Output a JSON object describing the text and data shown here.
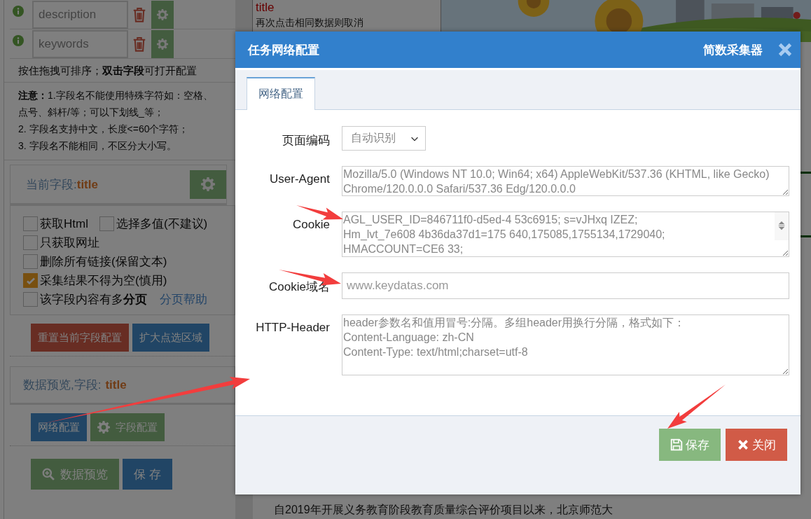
{
  "left_panel": {
    "fields": [
      {
        "name": "description"
      },
      {
        "name": "keywords"
      }
    ],
    "hint": "按住拖拽可排序；**双击字段**可打开配置",
    "notice": [
      "**注意：**1.字段名不能使用特殊字符如：空格、点号、斜杆/等；可以下划线_等；",
      "2. 字段名支持中文，长度<=60个字符；",
      "3. 字段名不能相同，不区分大小写。"
    ],
    "current_field": {
      "label": "当前字段:",
      "value": "title"
    },
    "option_lines": [
      {
        "items": [
          {
            "label": "获取Html",
            "checked": false
          },
          {
            "label": "选择多值(不建议)",
            "checked": false
          }
        ]
      },
      {
        "items": [
          {
            "label": "只获取网址",
            "checked": false
          }
        ]
      },
      {
        "items": [
          {
            "label": "删除所有链接(保留文本)",
            "checked": false
          }
        ]
      },
      {
        "items": [
          {
            "label": "采集结果不得为空(慎用)",
            "checked": true
          }
        ]
      },
      {
        "items": [
          {
            "label": "该字段内容有多**分页**",
            "checked": false
          }
        ],
        "link": "分页帮助"
      }
    ],
    "field_buttons": [
      {
        "label": "重置当前字段配置",
        "kind": "danger"
      },
      {
        "label": "扩大点选区域",
        "kind": "primary"
      }
    ],
    "preview": {
      "label": "数据预览,字段:",
      "value": "title"
    },
    "button_rows": [
      [
        {
          "label": "网络配置",
          "kind": "primary"
        },
        {
          "label": "字段配置",
          "kind": "success"
        }
      ],
      [
        {
          "label": "数据预览",
          "kind": "success"
        },
        {
          "label": "保 存",
          "kind": "primary"
        }
      ]
    ]
  },
  "page": {
    "tip_title": "title",
    "tip_text": "再次点击相同数据则取消",
    "paragraph": "自2019年开展义务教育阶段教育质量综合评价项目以来，北京师范大"
  },
  "dialog": {
    "title": "任务网络配置",
    "brand": "简数采集器",
    "tabs": [
      {
        "label": "网络配置",
        "selected": true
      }
    ],
    "fields": [
      {
        "label": "页面编码",
        "kind": "select",
        "value": "自动识别"
      },
      {
        "label": "User-Agent",
        "kind": "textarea",
        "value": "Mozilla/5.0 (Windows NT 10.0; Win64; x64) AppleWebKit/537.36 (KHTML, like Gecko) Chrome/120.0.0.0 Safari/537.36 Edg/120.0.0.0"
      },
      {
        "label": "Cookie",
        "kind": "textarea",
        "scroll": true,
        "value": "AGL_USER_ID=846711f0-d5ed-4 53c6915; s=vJHxq IZEZ;\nHm_lvt_7e608 4b36da37d1=175 640,175085,1755134,1729040;\nHMACCOUNT=CE6 33;"
      },
      {
        "label": "Cookie域名",
        "kind": "input",
        "placeholder": "www.keydatas.com"
      },
      {
        "label": "HTTP-Header",
        "kind": "textarea",
        "placeholder": "header参数名和值用冒号:分隔。多组header用换行分隔，格式如下：\nContent-Language: zh-CN\nContent-Type: text/html;charset=utf-8"
      }
    ],
    "buttons": [
      {
        "label": "保存",
        "kind": "success"
      },
      {
        "label": "关闭",
        "kind": "danger"
      }
    ]
  },
  "arrows": [
    {
      "kind": "arrow"
    },
    {
      "kind": "arrow"
    },
    {
      "kind": "arrow"
    },
    {
      "kind": "arrow"
    }
  ]
}
